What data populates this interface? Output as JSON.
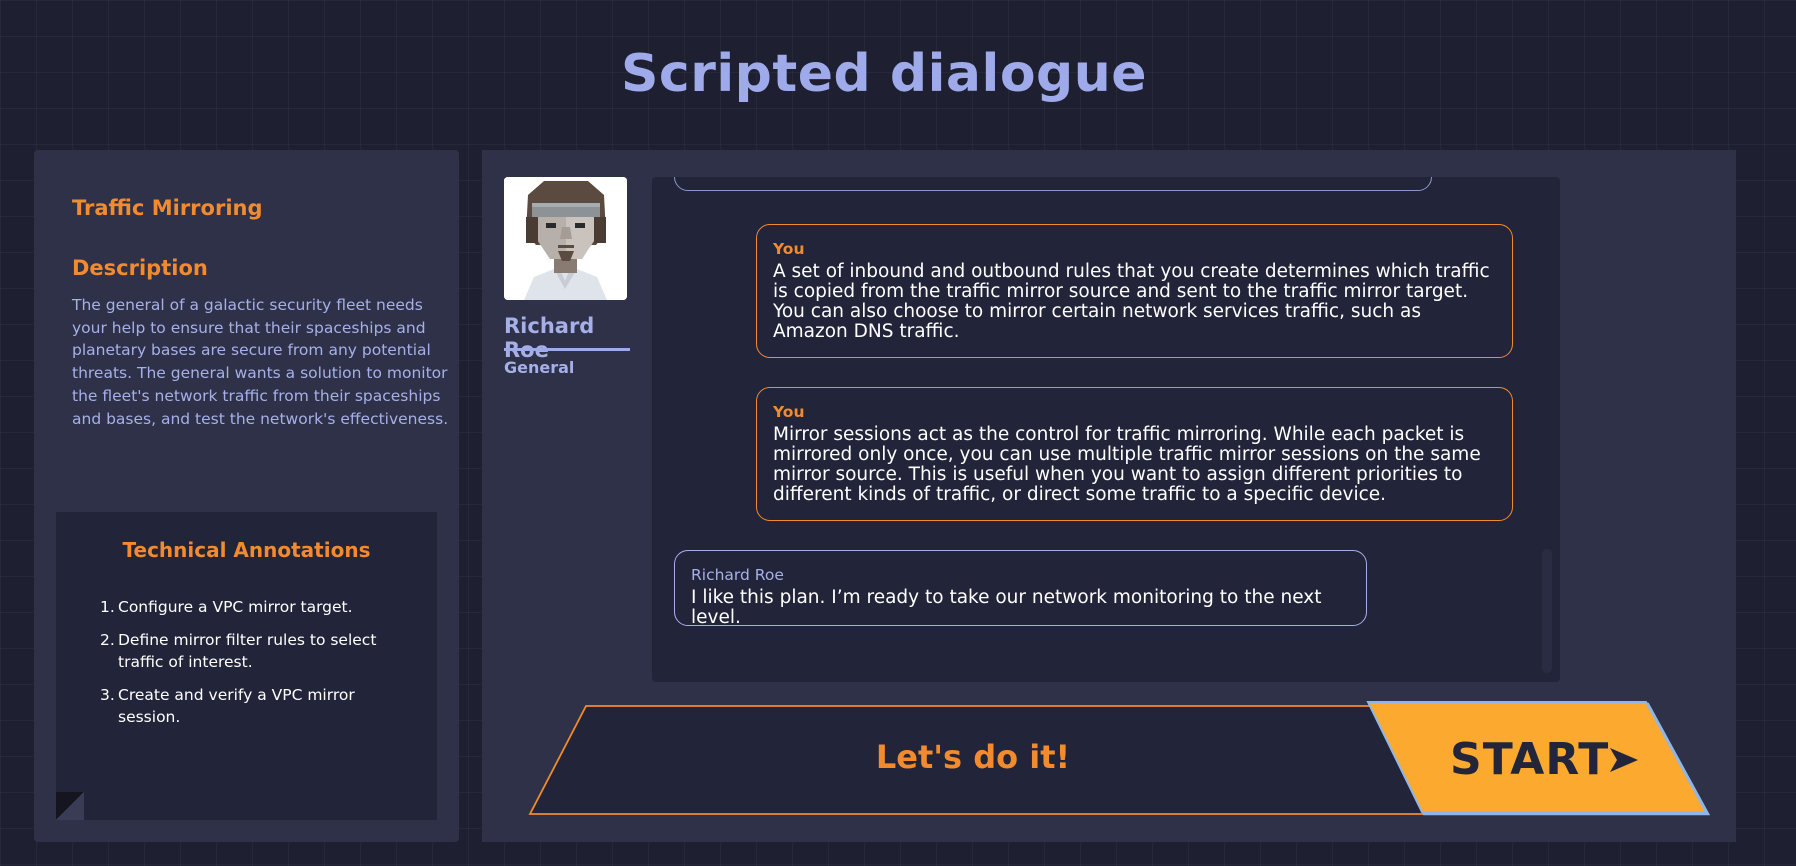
{
  "page": {
    "title": "Scripted dialogue"
  },
  "left_panel": {
    "topic": "Traffic Mirroring",
    "description_heading": "Description",
    "description": "The general of a galactic security fleet needs your help to ensure that their spaceships and planetary bases are secure from any potential threats. The general wants a solution to monitor the fleet's network traffic from their spaceships and bases, and test the network's effectiveness.",
    "annotations": {
      "title": "Technical Annotations",
      "items": [
        {
          "num": "1.",
          "text": "Configure a VPC mirror target."
        },
        {
          "num": "2.",
          "text": "Define mirror filter rules to select traffic of interest."
        },
        {
          "num": "3.",
          "text": "Create and verify a VPC mirror session."
        }
      ]
    }
  },
  "character": {
    "name": "Richard Roe",
    "role": "General",
    "avatar_icon": "character-portrait"
  },
  "chat": {
    "messages": [
      {
        "speaker": "You",
        "text": "A set of inbound and outbound rules that you create determines which traffic is copied from the traffic mirror source and sent to the traffic mirror target. You can also choose to mirror certain network services traffic, such as Amazon DNS traffic."
      },
      {
        "speaker": "You",
        "text": "Mirror sessions act as the control for traffic mirroring. While each packet is mirrored only once, you can use multiple traffic mirror sessions on the same mirror source. This is useful when you want to assign different priorities to different kinds of traffic, or direct some traffic to a specific device."
      },
      {
        "speaker": "Richard Roe",
        "text": "I like this plan. I’m ready to take our network monitoring to the next level."
      }
    ]
  },
  "actions": {
    "prompt": "Let's do it!",
    "start_label": "START",
    "start_icon": "send-arrow-icon"
  },
  "colors": {
    "background": "#1e2031",
    "panel": "#2f3148",
    "accent_orange": "#f28a2e",
    "accent_lavender": "#9eaae9",
    "start_fill": "#fba92f",
    "start_border": "#8fb6e8"
  }
}
